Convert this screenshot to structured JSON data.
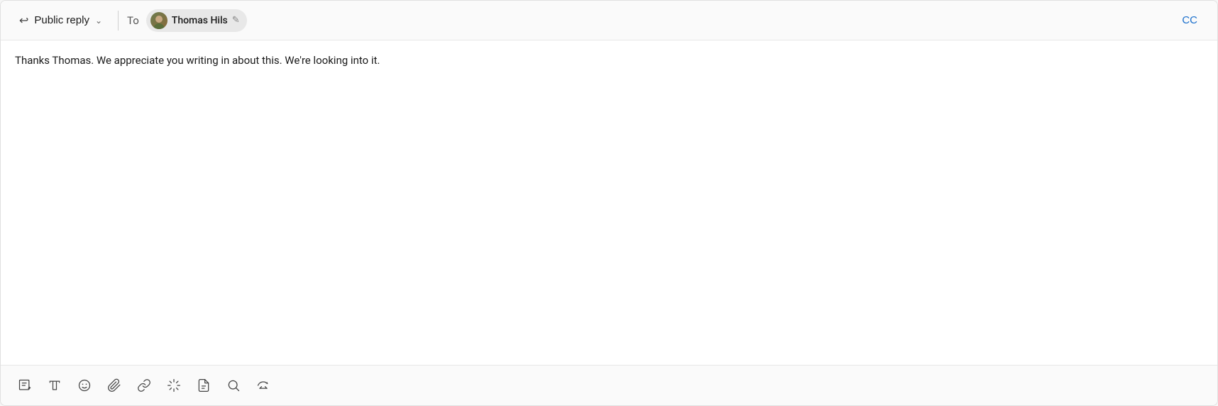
{
  "header": {
    "reply_type_label": "Public reply",
    "reply_icon": "↩",
    "chevron_icon": "∨",
    "to_label": "To",
    "recipient_name": "Thomas Hils",
    "cc_label": "CC"
  },
  "message": {
    "body": "Thanks Thomas. We appreciate you writing in about this. We're looking into it."
  },
  "toolbar": {
    "tools": [
      {
        "name": "compose-icon",
        "label": "Compose",
        "icon": "compose"
      },
      {
        "name": "text-icon",
        "label": "Text",
        "icon": "text"
      },
      {
        "name": "emoji-icon",
        "label": "Emoji",
        "icon": "emoji"
      },
      {
        "name": "attach-icon",
        "label": "Attachment",
        "icon": "attach"
      },
      {
        "name": "link-icon",
        "label": "Link",
        "icon": "link"
      },
      {
        "name": "ai-icon",
        "label": "AI Assist",
        "icon": "ai"
      },
      {
        "name": "article-icon",
        "label": "Article",
        "icon": "article"
      },
      {
        "name": "search-icon",
        "label": "Search",
        "icon": "search"
      },
      {
        "name": "clear-icon",
        "label": "Clear",
        "icon": "clear"
      }
    ]
  }
}
